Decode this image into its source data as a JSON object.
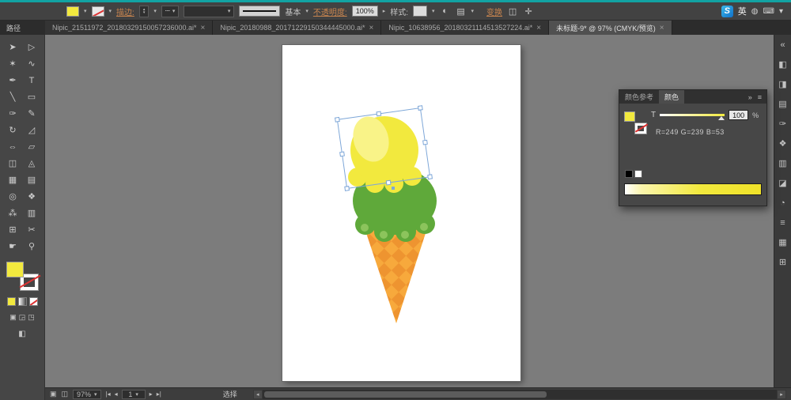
{
  "css_vars": {
    "accent-teal": "#12a3a3",
    "ui-link": "#c9854f",
    "fill-yellow": "#F2E93E",
    "scoop-top": "#F2E93E",
    "scoop-top-hi": "#F9F388",
    "scoop-green": "#5FA93A",
    "scoop-green-hi": "#8CC45C",
    "cone": "#F7A93C",
    "cone-dark": "#EE9430",
    "selection-blue": "#7EA7D8"
  },
  "glyphs": {
    "dropdown": "▾",
    "side_arrow": "▸",
    "up": "▴",
    "down": "▾",
    "dash_sample": "┈",
    "globe": "◐",
    "doc": "▤",
    "align_a": "◫",
    "align_b": "✛",
    "panel_collapse": "»",
    "panel_menu": "≡",
    "status_icon_a": "▣",
    "status_icon_b": "◫",
    "scroll_left": "◂",
    "scroll_right": "▸",
    "ime_dot": "◍",
    "ime_kbd": "⌨"
  },
  "options_bar": {
    "stroke_label": "描边:",
    "brush_name": "基本",
    "opacity_label": "不透明度:",
    "opacity_value": "100%",
    "style_label": "样式:",
    "transform_label": "变换"
  },
  "ime": {
    "logo": "S",
    "lang": "英"
  },
  "tab_bar": {
    "left_label": "路径",
    "tabs": [
      {
        "label": "Nipic_21511972_20180329150057236000.ai*",
        "close": "×",
        "active": false
      },
      {
        "label": "Nipic_20180988_20171229150344445000.ai*",
        "close": "×",
        "active": false
      },
      {
        "label": "Nipic_10638956_20180321114513527224.ai*",
        "close": "×",
        "active": false
      },
      {
        "label": "未标题-9* @ 97% (CMYK/预览)",
        "close": "×",
        "active": true
      }
    ]
  },
  "toolbar": {
    "tools": [
      {
        "name": "selection-tool",
        "glyph": "➤"
      },
      {
        "name": "direct-selection-tool",
        "glyph": "▷"
      },
      {
        "name": "magic-wand-tool",
        "glyph": "✶"
      },
      {
        "name": "lasso-tool",
        "glyph": "∿"
      },
      {
        "name": "pen-tool",
        "glyph": "✒"
      },
      {
        "name": "type-tool",
        "glyph": "T"
      },
      {
        "name": "line-segment-tool",
        "glyph": "╲"
      },
      {
        "name": "rectangle-tool",
        "glyph": "▭"
      },
      {
        "name": "paintbrush-tool",
        "glyph": "✑"
      },
      {
        "name": "pencil-tool",
        "glyph": "✎"
      },
      {
        "name": "rotate-tool",
        "glyph": "↻"
      },
      {
        "name": "scale-tool",
        "glyph": "◿"
      },
      {
        "name": "width-tool",
        "glyph": "⇔"
      },
      {
        "name": "free-transform-tool",
        "glyph": "▱"
      },
      {
        "name": "shape-builder-tool",
        "glyph": "◫"
      },
      {
        "name": "perspective-grid-tool",
        "glyph": "◬"
      },
      {
        "name": "mesh-tool",
        "glyph": "▦"
      },
      {
        "name": "gradient-tool",
        "glyph": "▤"
      },
      {
        "name": "eyedropper-tool",
        "glyph": "◎"
      },
      {
        "name": "blend-tool",
        "glyph": "❖"
      },
      {
        "name": "symbol-sprayer-tool",
        "glyph": "⁂"
      },
      {
        "name": "column-graph-tool",
        "glyph": "▥"
      },
      {
        "name": "artboard-tool",
        "glyph": "⊞"
      },
      {
        "name": "slice-tool",
        "glyph": "✂"
      },
      {
        "name": "hand-tool",
        "glyph": "☛"
      },
      {
        "name": "zoom-tool",
        "glyph": "⚲"
      }
    ],
    "draw_mode_a": "▣",
    "draw_mode_b": "◲",
    "draw_mode_c": "◳",
    "screen_mode": "◧"
  },
  "dock": {
    "icons": [
      {
        "name": "expand-dock-icon",
        "glyph": "«"
      },
      {
        "name": "color-panel-icon",
        "glyph": "◧"
      },
      {
        "name": "color-guide-panel-icon",
        "glyph": "◨"
      },
      {
        "name": "swatches-panel-icon",
        "glyph": "▤"
      },
      {
        "name": "brushes-panel-icon",
        "glyph": "✑"
      },
      {
        "name": "symbols-panel-icon",
        "glyph": "❖"
      },
      {
        "name": "stroke-panel-icon",
        "glyph": "▥"
      },
      {
        "name": "gradient-panel-icon",
        "glyph": "◪"
      },
      {
        "name": "transparency-panel-icon",
        "glyph": "◔"
      },
      {
        "name": "appearance-panel-icon",
        "glyph": "≡"
      },
      {
        "name": "layers-panel-icon",
        "glyph": "▦"
      },
      {
        "name": "artboards-panel-icon",
        "glyph": "⊞"
      }
    ]
  },
  "color_panel": {
    "tab_color_guide": "颜色参考",
    "tab_color": "颜色",
    "tint_label": "T",
    "tint_value": "100",
    "percent": "%",
    "rgb_readout": "R=249 G=239 B=53"
  },
  "status_bar": {
    "zoom": "97%",
    "nav_first": "|◂",
    "nav_prev": "◂",
    "nav_value": "1",
    "nav_next": "▸",
    "nav_last": "▸|",
    "status_text": "选择"
  }
}
